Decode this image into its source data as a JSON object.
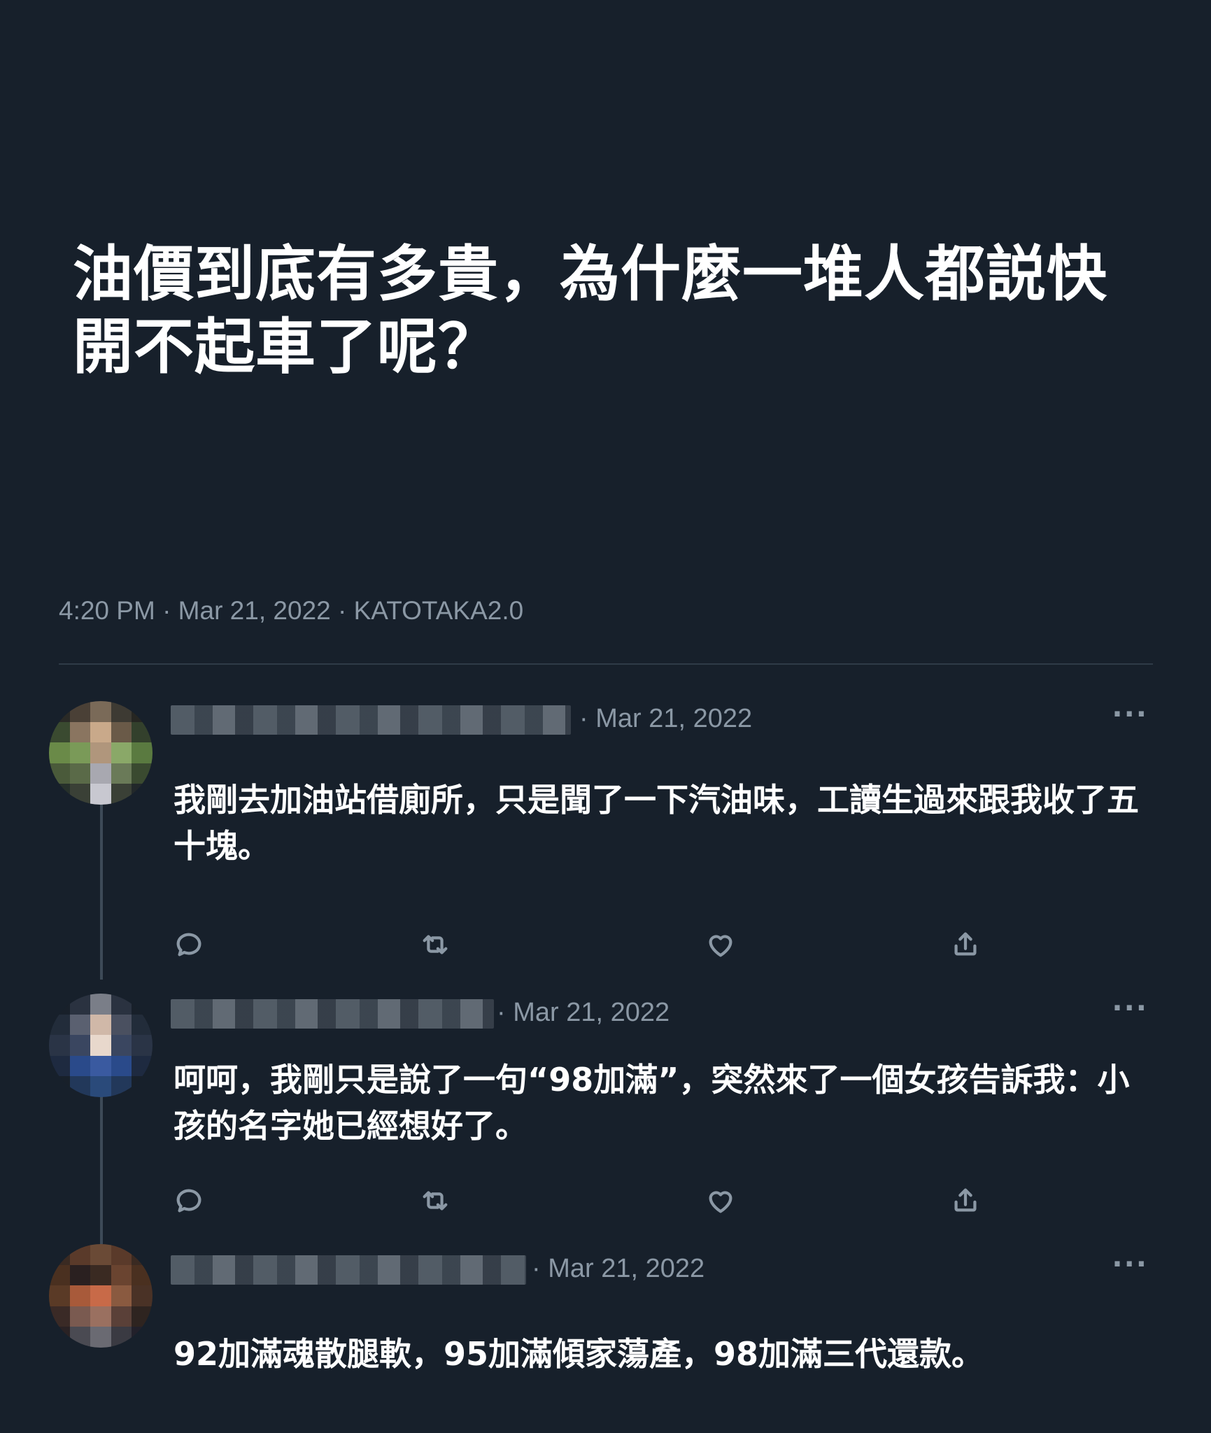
{
  "post": {
    "title": "油價到底有多貴，為什麼一堆人都説快開不起車了呢？",
    "meta": "4:20 PM · Mar 21, 2022 · KATOTAKA2.0"
  },
  "replies": [
    {
      "date": "· Mar 21, 2022",
      "more": "···",
      "text": "我剛去加油站借廁所，只是聞了一下汽油味，工讀生過來跟我收了五十塊。"
    },
    {
      "date": "· Mar 21, 2022",
      "more": "···",
      "text": "呵呵，我剛只是說了一句“98加滿”，突然來了一個女孩告訴我：小孩的名字她已經想好了。"
    },
    {
      "date": "· Mar 21, 2022",
      "more": "···",
      "text": "92加滿魂散腿軟，95加滿傾家蕩產，98加滿三代還款。"
    }
  ],
  "icons": {
    "reply": "reply-icon",
    "retweet": "retweet-icon",
    "like": "heart-icon",
    "share": "share-icon"
  },
  "colors": {
    "background": "#17202b",
    "muted": "#8b98a5",
    "divider": "#2f3b47"
  }
}
